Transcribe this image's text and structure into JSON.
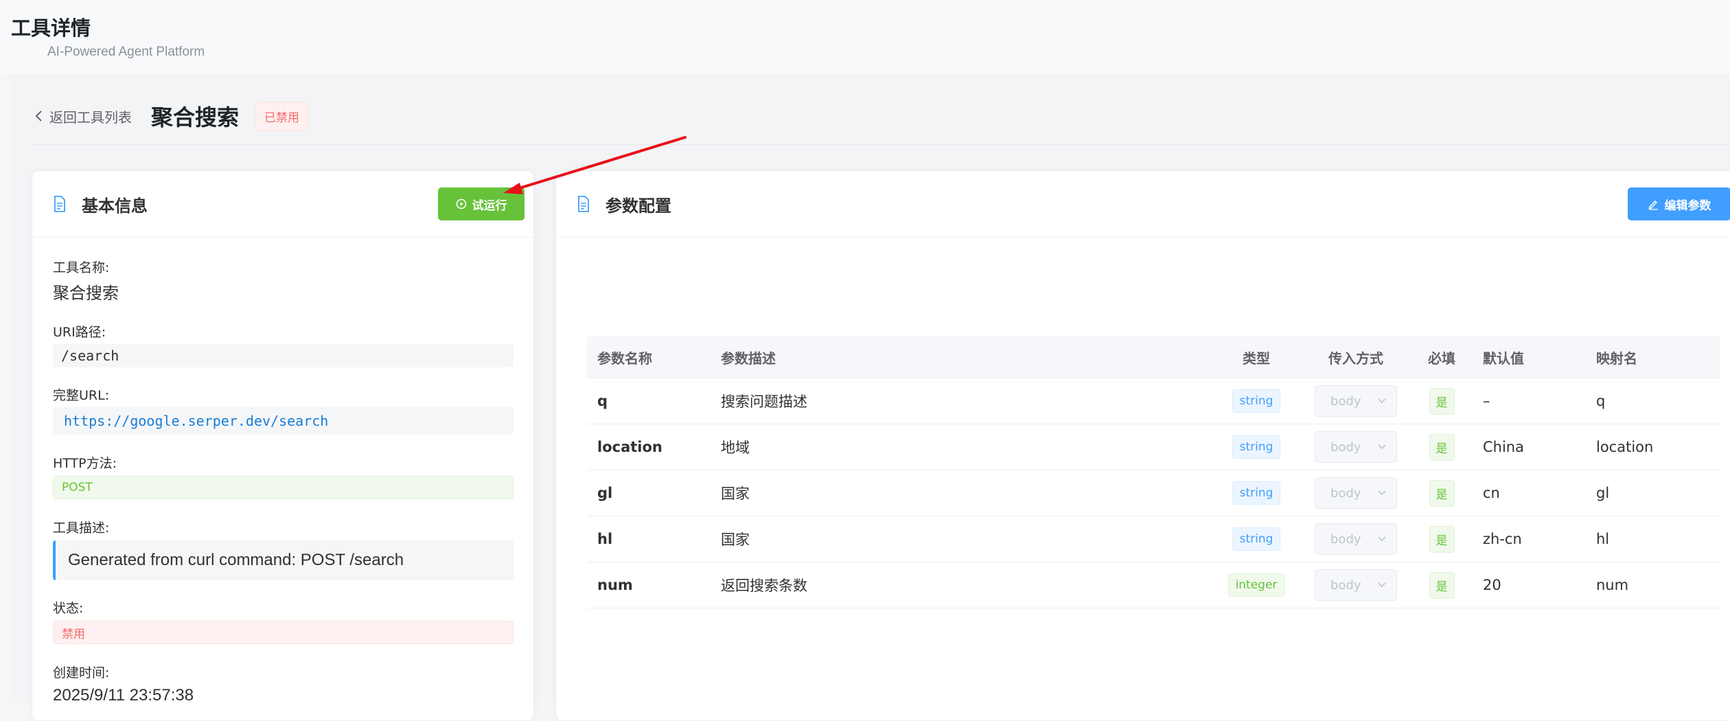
{
  "app": {
    "title": "工具详情",
    "subtitle": "AI-Powered Agent Platform"
  },
  "header": {
    "back_label": "返回工具列表",
    "tool_name": "聚合搜索",
    "status_label": "已禁用"
  },
  "basic_info": {
    "title": "基本信息",
    "run_button": "试运行",
    "fields": {
      "name_label": "工具名称:",
      "name_value": "聚合搜索",
      "uri_label": "URI路径:",
      "uri_value": "/search",
      "url_label": "完整URL:",
      "url_value": "https://google.serper.dev/search",
      "method_label": "HTTP方法:",
      "method_value": "POST",
      "desc_label": "工具描述:",
      "desc_value": "Generated from curl command: POST /search",
      "status_label": "状态:",
      "status_value": "禁用",
      "created_label": "创建时间:",
      "created_value": "2025/9/11 23:57:38"
    }
  },
  "params": {
    "title": "参数配置",
    "edit_button": "编辑参数",
    "columns": [
      "参数名称",
      "参数描述",
      "类型",
      "传入方式",
      "必填",
      "默认值",
      "映射名"
    ],
    "rows": [
      {
        "name": "q",
        "desc": "搜索问题描述",
        "type": "string",
        "method": "body",
        "required": "是",
        "default": "–",
        "mapping": "q"
      },
      {
        "name": "location",
        "desc": "地域",
        "type": "string",
        "method": "body",
        "required": "是",
        "default": "China",
        "mapping": "location"
      },
      {
        "name": "gl",
        "desc": "国家",
        "type": "string",
        "method": "body",
        "required": "是",
        "default": "cn",
        "mapping": "gl"
      },
      {
        "name": "hl",
        "desc": "国家",
        "type": "string",
        "method": "body",
        "required": "是",
        "default": "zh-cn",
        "mapping": "hl"
      },
      {
        "name": "num",
        "desc": "返回搜索条数",
        "type": "integer",
        "method": "body",
        "required": "是",
        "default": "20",
        "mapping": "num"
      }
    ]
  },
  "colors": {
    "accent_blue": "#409eff",
    "accent_green": "#67c23a",
    "danger": "#f56c6c",
    "arrow_red": "#e8101a"
  }
}
